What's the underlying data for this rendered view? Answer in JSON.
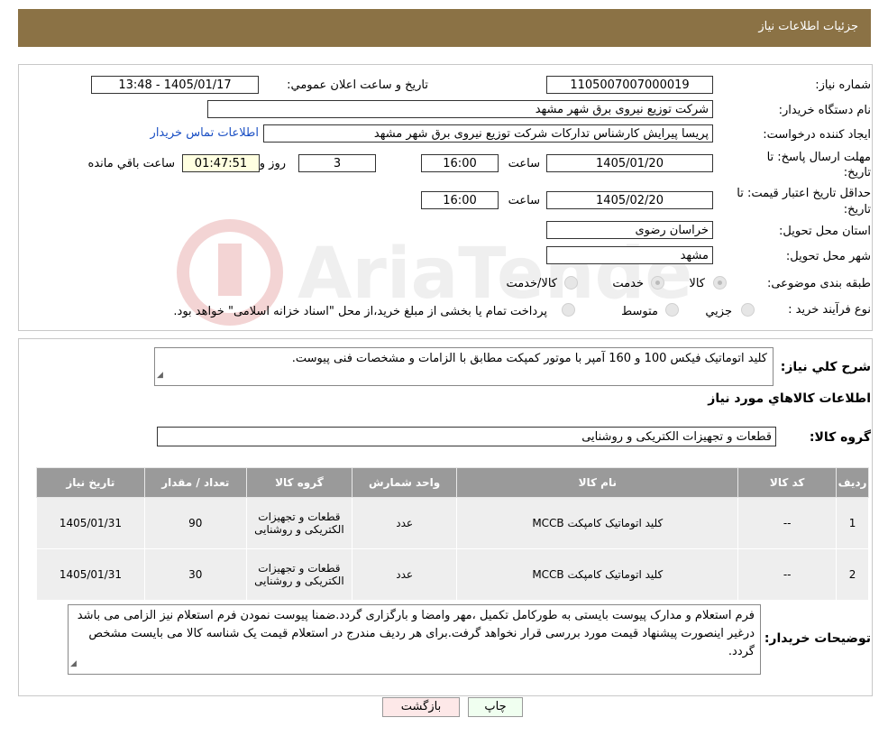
{
  "header": {
    "title": "جزئیات اطلاعات نیاز"
  },
  "form": {
    "need_number_label": "شماره نیاز:",
    "need_number": "1105007007000019",
    "announce_label": "تاریخ و ساعت اعلان عمومي:",
    "announce_value": "1405/01/17 - 13:48",
    "buyer_org_label": "نام دستگاه خریدار:",
    "buyer_org": "شرکت توزیع نیروی برق شهر مشهد",
    "creator_label": "ایجاد کننده درخواست:",
    "creator": "پریسا پیرایش کارشناس تدارکات شرکت توزیع نیروی برق شهر مشهد",
    "contact_link": "اطلاعات تماس خریدار",
    "reply_deadline_label_1": "مهلت ارسال پاسخ: تا",
    "reply_deadline_label_2": "تاریخ:",
    "reply_date": "1405/01/20",
    "time_label": "ساعت",
    "reply_time": "16:00",
    "days_value": "3",
    "days_label": "روز و",
    "remaining_time": "01:47:51",
    "remaining_label": "ساعت باقي مانده",
    "validity_label_1": "حداقل تاريخ اعتبار قيمت: تا",
    "validity_label_2": "تاریخ:",
    "validity_date": "1405/02/20",
    "validity_time": "16:00",
    "province_label": "استان محل تحویل:",
    "province": "خراسان رضوی",
    "city_label": "شهر محل تحویل:",
    "city": "مشهد",
    "category_label": "طبقه بندی موضوعی:",
    "category_options": [
      "کالا",
      "خدمت",
      "کالا/خدمت"
    ],
    "process_label": "نوع فرآیند خرید :",
    "process_options": [
      "جزیي",
      "متوسط"
    ],
    "process_note": "پرداخت تمام یا بخشی از مبلغ خرید،از محل \"اسناد خزانه اسلامی\" خواهد بود."
  },
  "description": {
    "label": "شرح کلي نیاز:",
    "text": "کلید اتوماتیک فیکس  100 و 160 آمپر با موتور کمپکت مطابق با الزامات و مشخصات فنی پیوست."
  },
  "goods": {
    "section_title": "اطلاعات کالاهاي مورد نیاز",
    "group_label": "گروه کالا:",
    "group_value": "قطعات و تجهیزات الکتریکی و روشنایی",
    "columns": [
      "ردیف",
      "کد کالا",
      "نام کالا",
      "واحد شمارش",
      "گروه کالا",
      "تعداد / مقدار",
      "تاریخ نیاز"
    ],
    "rows": [
      {
        "row": "1",
        "code": "--",
        "name": "کلید اتوماتیک کامپکت MCCB",
        "unit": "عدد",
        "group": "قطعات و تجهیزات الکتریکی و روشنایی",
        "qty": "90",
        "date": "1405/01/31"
      },
      {
        "row": "2",
        "code": "--",
        "name": "کلید اتوماتیک کامپکت MCCB",
        "unit": "عدد",
        "group": "قطعات و تجهیزات الکتریکی و روشنایی",
        "qty": "30",
        "date": "1405/01/31"
      }
    ]
  },
  "buyer_notes": {
    "label": "توضیحات خریدار:",
    "text": "فرم استعلام و مدارک پیوست بایستی به طورکامل تکمیل ،مهر وامضا و بارگزاری گردد.ضمنا پیوست نمودن فرم استعلام نیز الزامی می باشد درغیر اینصورت پیشنهاد قیمت مورد بررسی قرار نخواهد گرفت.برای هر ردیف مندرج در استعلام قیمت یک شناسه کالا می بایست مشخص گردد."
  },
  "buttons": {
    "print": "چاپ",
    "back": "بازگشت"
  },
  "watermark": {
    "text": "AriaTender.neT"
  },
  "colors": {
    "header_bg": "#8b7245",
    "table_header_bg": "#9a9a9a",
    "link": "#1a4fc4"
  }
}
